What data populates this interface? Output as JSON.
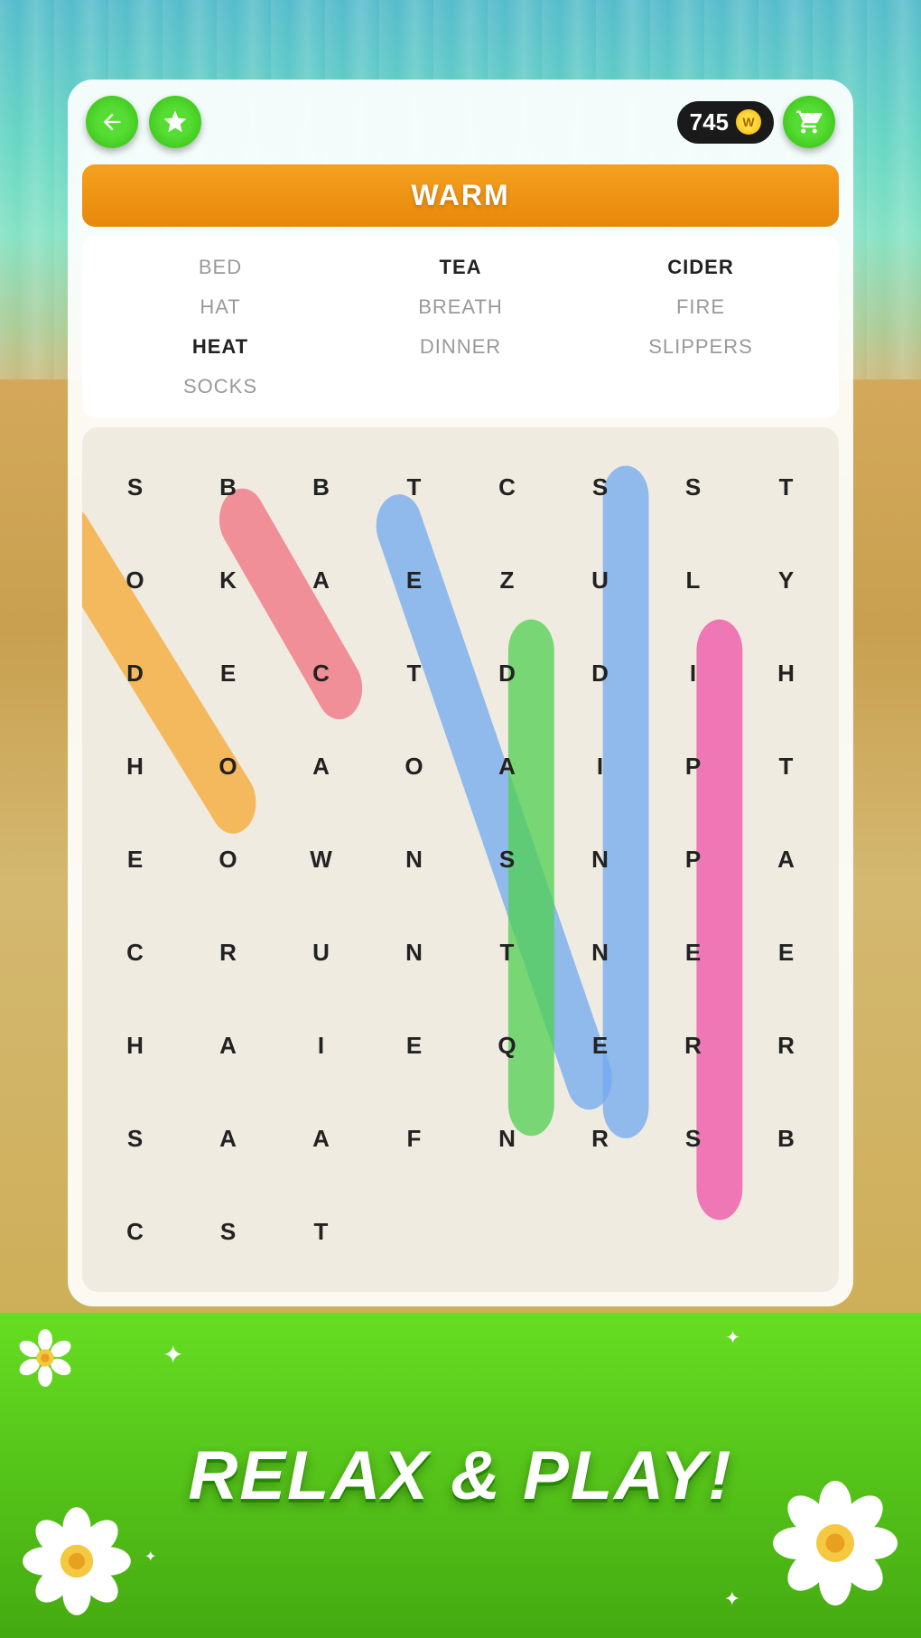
{
  "header": {
    "back_label": "←",
    "coins": "745",
    "coin_symbol": "W",
    "cart_label": "🛒"
  },
  "category": {
    "label": "WARM"
  },
  "words": [
    {
      "text": "BED",
      "state": "normal"
    },
    {
      "text": "TEA",
      "state": "found"
    },
    {
      "text": "CIDER",
      "state": "found"
    },
    {
      "text": "HAT",
      "state": "normal"
    },
    {
      "text": "BREATH",
      "state": "normal"
    },
    {
      "text": "FIRE",
      "state": "normal"
    },
    {
      "text": "HEAT",
      "state": "found"
    },
    {
      "text": "DINNER",
      "state": "normal"
    },
    {
      "text": "SLIPPERS",
      "state": "normal"
    },
    {
      "text": "SOCKS",
      "state": "normal"
    }
  ],
  "grid": {
    "cells": [
      "S",
      "B",
      "B",
      "T",
      "C",
      "S",
      "S",
      "T",
      "O",
      "K",
      "A",
      "E",
      "Z",
      "U",
      "L",
      "Y",
      "D",
      "E",
      "C",
      "T",
      "D",
      "D",
      "I",
      "H",
      "H",
      "O",
      "A",
      "O",
      "A",
      "I",
      "P",
      "T",
      "E",
      "O",
      "W",
      "N",
      "S",
      "N",
      "P",
      "A",
      "C",
      "R",
      "U",
      "N",
      "T",
      "N",
      "E",
      "E",
      "H",
      "A",
      "I",
      "E",
      "Q",
      "E",
      "R",
      "R",
      "S",
      "A",
      "A",
      "F",
      "N",
      "R",
      "S",
      "B",
      "C",
      "S",
      "T",
      "",
      "",
      "",
      "",
      ""
    ]
  },
  "banner": {
    "text": "RELAX & PLAY!"
  }
}
